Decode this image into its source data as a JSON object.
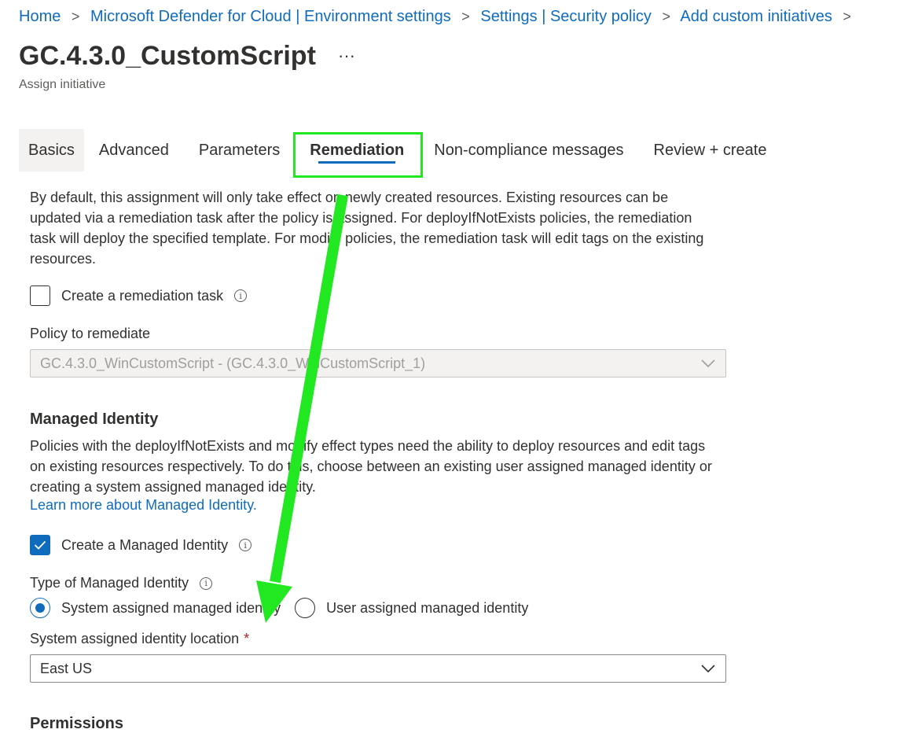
{
  "breadcrumb": {
    "items": [
      "Home",
      "Microsoft Defender for Cloud | Environment settings",
      "Settings | Security policy",
      "Add custom initiatives"
    ],
    "separator": ">"
  },
  "page": {
    "title": "GC.4.3.0_CustomScript",
    "more_label": "···",
    "subtitle": "Assign initiative"
  },
  "tabs": [
    "Basics",
    "Advanced",
    "Parameters",
    "Remediation",
    "Non-compliance messages",
    "Review + create"
  ],
  "active_tab": "Remediation",
  "remediation": {
    "description": "By default, this assignment will only take effect on newly created resources. Existing resources can be updated via a remediation task after the policy is assigned. For deployIfNotExists policies, the remediation task will deploy the specified template. For modify policies, the remediation task will edit tags on the existing resources.",
    "create_task_label": "Create a remediation task",
    "create_task_checked": false,
    "policy_label": "Policy to remediate",
    "policy_value": "GC.4.3.0_WinCustomScript - (GC.4.3.0_WinCustomScript_1)"
  },
  "managed_identity": {
    "heading": "Managed Identity",
    "description": "Policies with the deployIfNotExists and modify effect types need the ability to deploy resources and edit tags on existing resources respectively. To do this, choose between an existing user assigned managed identity or creating a system assigned managed identity.",
    "learn_more": "Learn more about Managed Identity.",
    "create_label": "Create a Managed Identity",
    "create_checked": true,
    "type_label": "Type of Managed Identity",
    "type_options": [
      "System assigned managed identity",
      "User assigned managed identity"
    ],
    "type_selected": "System assigned managed identity",
    "location_label": "System assigned identity location",
    "required_mark": "*",
    "location_value": "East US"
  },
  "permissions": {
    "heading": "Permissions"
  },
  "colors": {
    "accent": "#0f6cbd",
    "annotation": "#22e822",
    "required": "#a4262c"
  }
}
